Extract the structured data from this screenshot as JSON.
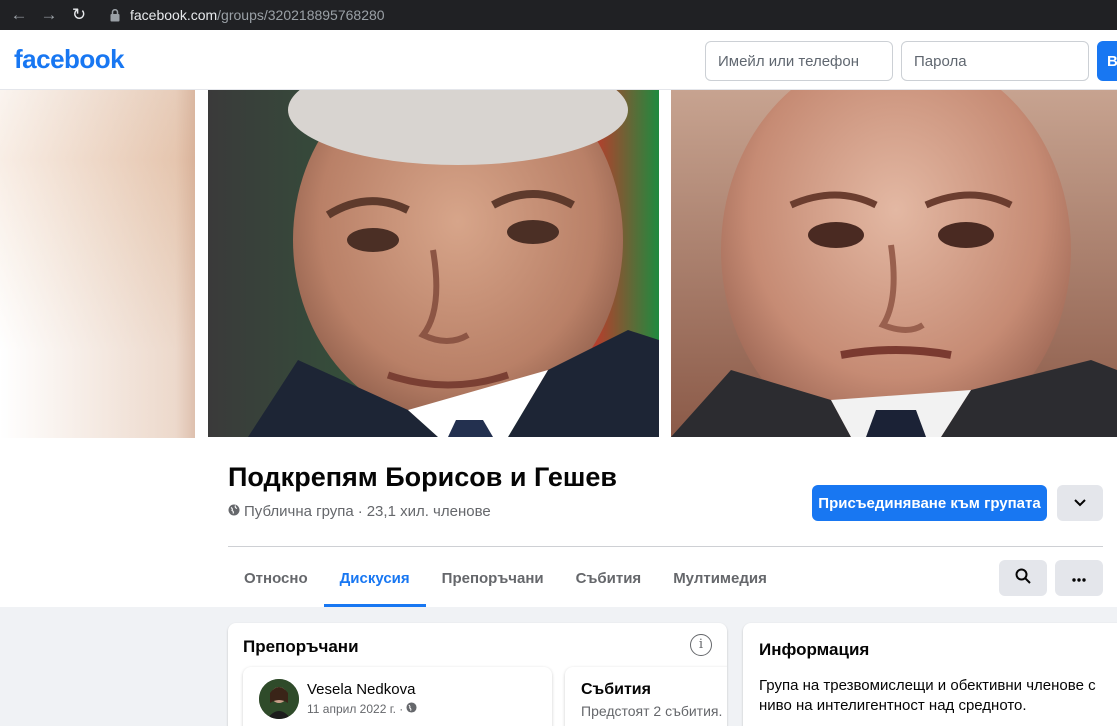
{
  "browser": {
    "url_host": "facebook.com",
    "url_path": "/groups/320218895768280"
  },
  "header": {
    "logo": "facebook",
    "email_placeholder": "Имейл или телефон",
    "password_placeholder": "Парола",
    "login_label": "В"
  },
  "group": {
    "name": "Подкрепям Борисов и Гешев",
    "privacy": "Публична група",
    "separator": "·",
    "members": "23,1 хил. членове",
    "join_label": "Присъединяване към групата"
  },
  "tabs": [
    {
      "label": "Относно",
      "active": false
    },
    {
      "label": "Дискусия",
      "active": true
    },
    {
      "label": "Препоръчани",
      "active": false
    },
    {
      "label": "Събития",
      "active": false
    },
    {
      "label": "Мултимедия",
      "active": false
    }
  ],
  "featured": {
    "title": "Препоръчани",
    "post": {
      "author": "Vesela Nedkova",
      "date": "11 април 2022 г. ·"
    },
    "events": {
      "title": "Събития",
      "subtitle": "Предстоят 2 събития."
    }
  },
  "info": {
    "title": "Информация",
    "description": "Група на трезвомислещи и обективни членове с ниво на интелигентност над средното."
  },
  "colors": {
    "brand": "#1877f2",
    "page_bg": "#f0f2f5"
  }
}
